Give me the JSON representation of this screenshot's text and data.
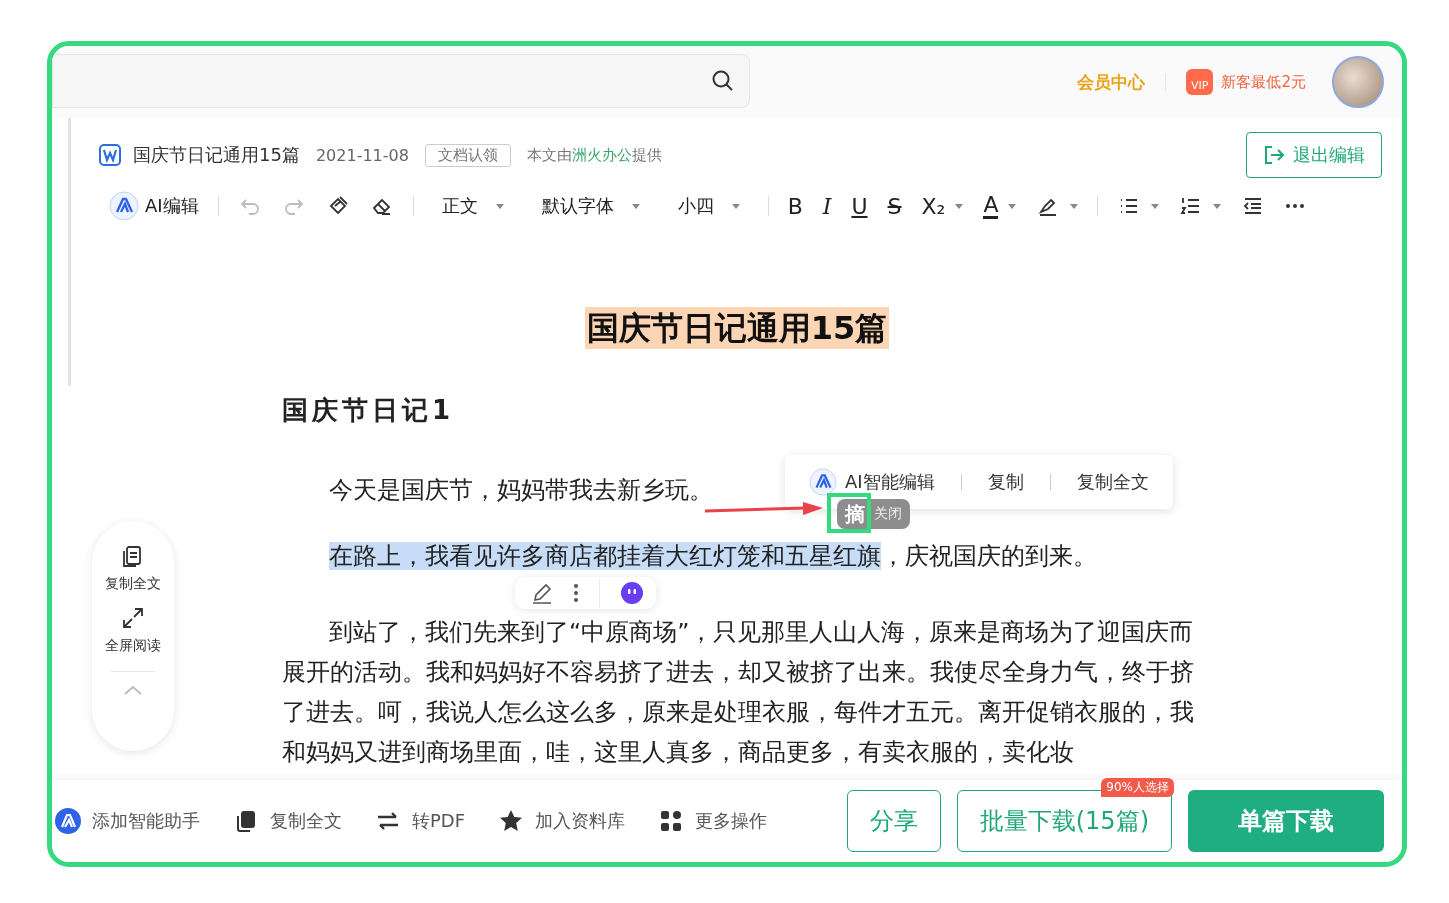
{
  "top_bar": {
    "member_center": "会员中心",
    "vip_badge": "VIP",
    "promo": "新客最低2元"
  },
  "doc_header": {
    "title": "国庆节日记通用15篇",
    "date": "2021-11-08",
    "claim_tag": "文档认领",
    "provider_prefix": "本文由",
    "provider": "洲火办公",
    "provider_suffix": "提供",
    "exit_button": "退出编辑"
  },
  "toolbar": [
    {
      "kind": "ai",
      "label": "AI编辑"
    },
    {
      "kind": "sep"
    },
    {
      "kind": "undo",
      "disabled": true
    },
    {
      "kind": "redo",
      "disabled": true
    },
    {
      "kind": "painter"
    },
    {
      "kind": "eraser"
    },
    {
      "kind": "sep"
    },
    {
      "kind": "dropdown",
      "label": "正文"
    },
    {
      "kind": "dropdown",
      "label": "默认字体"
    },
    {
      "kind": "dropdown",
      "label": "小四"
    },
    {
      "kind": "sep"
    },
    {
      "kind": "bold",
      "label": "B"
    },
    {
      "kind": "italic",
      "label": "I"
    },
    {
      "kind": "underline",
      "label": "U"
    },
    {
      "kind": "strike",
      "label": "S"
    },
    {
      "kind": "subscript",
      "label": "X₂",
      "caret": true
    },
    {
      "kind": "font-color",
      "label": "A",
      "caret": true
    },
    {
      "kind": "highlight",
      "caret": true
    },
    {
      "kind": "sep"
    },
    {
      "kind": "bullets",
      "caret": true
    },
    {
      "kind": "numbering",
      "caret": true
    },
    {
      "kind": "outdent"
    },
    {
      "kind": "more"
    }
  ],
  "document": {
    "title": "国庆节日记通用15篇",
    "heading": "国庆节日记1",
    "paragraphs": [
      {
        "segments": [
          {
            "text": "今天是国庆节，妈妈带我去新乡玩。",
            "selected": false
          }
        ]
      },
      {
        "segments": [
          {
            "text": "在路上，我看见许多商店都挂着大红灯笼和五星红旗",
            "selected": true
          },
          {
            "text": "，庆祝国庆的到来。",
            "selected": false
          }
        ]
      },
      {
        "segments": [
          {
            "text": "到站了，我们先来到了“中原商场”，只见那里人山人海，原来是商场为了迎国庆而展开的活动。我和妈妈好不容易挤了进去，却又被挤了出来。我使尽全身力气，终于挤了进去。呵，我说人怎么这么多，原来是处理衣服，每件才五元。离开促销衣服的，我和妈妈又进到商场里面，哇，这里人真多，商品更多，有卖衣服的，卖化妆",
            "selected": false
          }
        ]
      }
    ]
  },
  "selection_menu": [
    {
      "kind": "ai",
      "label": "AI智能编辑"
    },
    {
      "kind": "text",
      "label": "复制"
    },
    {
      "kind": "text",
      "label": "复制全文"
    }
  ],
  "excerpt_tip": {
    "label": "摘",
    "close": "关闭"
  },
  "side_panel": [
    {
      "kind": "copy",
      "label": "复制全文"
    },
    {
      "kind": "fullscreen",
      "label": "全屏阅读"
    }
  ],
  "footer": {
    "actions": [
      {
        "kind": "assistant",
        "label": "添加智能助手"
      },
      {
        "kind": "copy",
        "label": "复制全文"
      },
      {
        "kind": "pdf",
        "label": "转PDF"
      },
      {
        "kind": "star",
        "label": "加入资料库"
      },
      {
        "kind": "grid",
        "label": "更多操作"
      }
    ],
    "buttons": [
      {
        "kind": "outline",
        "label": "分享"
      },
      {
        "kind": "outline",
        "label": "批量下载(15篇)",
        "badge": "90%人选择"
      },
      {
        "kind": "primary",
        "label": "单篇下载"
      }
    ]
  }
}
